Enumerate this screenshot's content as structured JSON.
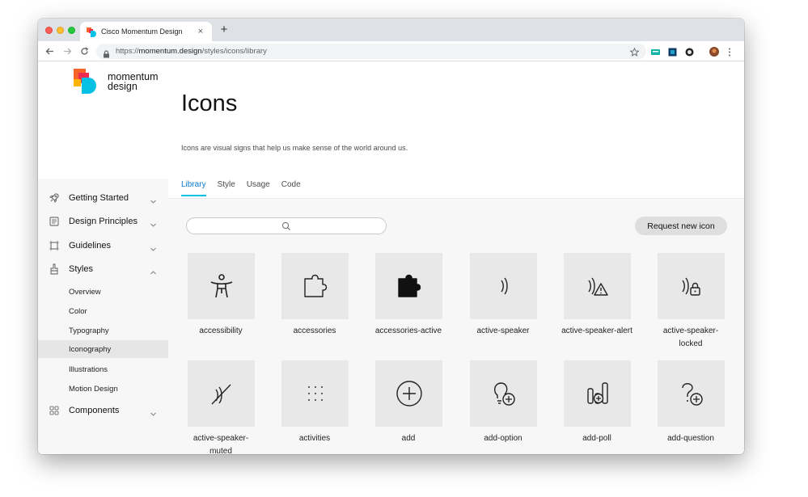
{
  "browser": {
    "tab_title": "Cisco Momentum Design",
    "new_tab_label": "+",
    "tab_close_label": "×",
    "url_prefix": "https://",
    "url_host": "momentum.design",
    "url_path": "/styles/icons/library"
  },
  "sidebar": {
    "logo_line1": "momentum",
    "logo_line2": "design",
    "items": [
      {
        "label": "Getting Started",
        "icon": "rocket-icon",
        "expanded": false
      },
      {
        "label": "Design Principles",
        "icon": "document-icon",
        "expanded": false
      },
      {
        "label": "Guidelines",
        "icon": "guidelines-icon",
        "expanded": false
      },
      {
        "label": "Styles",
        "icon": "brush-icon",
        "expanded": true
      },
      {
        "label": "Components",
        "icon": "components-icon",
        "expanded": false
      }
    ],
    "sub_items": [
      "Overview",
      "Color",
      "Typography",
      "Iconography",
      "Illustrations",
      "Motion Design"
    ],
    "active_sub_item": "Iconography"
  },
  "main": {
    "title": "Icons",
    "subtitle": "Icons are visual signs that help us make sense of the world around us.",
    "tabs": [
      "Library",
      "Style",
      "Usage",
      "Code"
    ],
    "active_tab": "Library",
    "request_button": "Request new icon",
    "icons": [
      {
        "name": "accessibility",
        "icon": "accessibility-icon"
      },
      {
        "name": "accessories",
        "icon": "puzzle-outline-icon"
      },
      {
        "name": "accessories-active",
        "icon": "puzzle-filled-icon"
      },
      {
        "name": "active-speaker",
        "icon": "active-speaker-icon"
      },
      {
        "name": "active-speaker-alert",
        "icon": "active-speaker-alert-icon"
      },
      {
        "name": "active-speaker-locked",
        "name_lines": [
          "active-speaker-",
          "locked"
        ],
        "icon": "active-speaker-locked-icon"
      },
      {
        "name": "active-speaker-muted",
        "name_lines": [
          "active-speaker-",
          "muted"
        ],
        "icon": "active-speaker-muted-icon"
      },
      {
        "name": "activities",
        "icon": "activities-icon"
      },
      {
        "name": "add",
        "icon": "add-icon"
      },
      {
        "name": "add-option",
        "icon": "add-option-icon"
      },
      {
        "name": "add-poll",
        "icon": "add-poll-icon"
      },
      {
        "name": "add-question",
        "icon": "add-question-icon"
      }
    ]
  },
  "colors": {
    "accent_tab": "#07c1e4",
    "tile_bg": "#e8e8e8",
    "logo_orange": "#f7642a",
    "logo_red": "#ee2c53",
    "logo_yellow": "#ffb400",
    "logo_blue": "#07c1e4"
  }
}
